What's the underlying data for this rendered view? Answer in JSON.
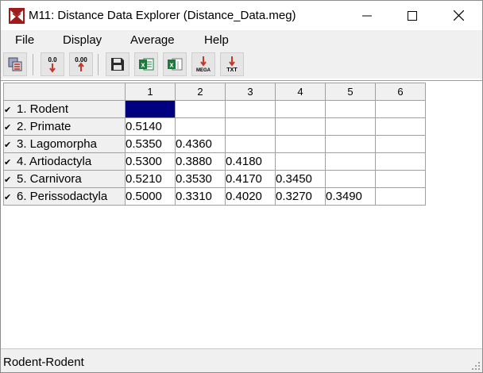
{
  "window": {
    "title": "M11: Distance Data Explorer (Distance_Data.meg)"
  },
  "menu": [
    "File",
    "Display",
    "Average",
    "Help"
  ],
  "toolbar": {
    "buttons": [
      {
        "name": "options-icon",
        "label": ""
      },
      {
        "name": "decrease-decimals-icon",
        "label": "0.0"
      },
      {
        "name": "increase-decimals-icon",
        "label": "0.00"
      },
      {
        "name": "save-icon",
        "label": ""
      },
      {
        "name": "export-excel-icon",
        "label": ""
      },
      {
        "name": "export-excel-alt-icon",
        "label": ""
      },
      {
        "name": "export-mega-icon",
        "label": "MEGA"
      },
      {
        "name": "export-txt-icon",
        "label": "TXT"
      }
    ]
  },
  "table": {
    "columns": [
      "1",
      "2",
      "3",
      "4",
      "5",
      "6"
    ],
    "rows": [
      {
        "label": "1. Rodent",
        "checked": true,
        "values": [
          "",
          "",
          "",
          "",
          "",
          ""
        ]
      },
      {
        "label": "2. Primate",
        "checked": true,
        "values": [
          "0.5140",
          "",
          "",
          "",
          "",
          ""
        ]
      },
      {
        "label": "3. Lagomorpha",
        "checked": true,
        "values": [
          "0.5350",
          "0.4360",
          "",
          "",
          "",
          ""
        ]
      },
      {
        "label": "4. Artiodactyla",
        "checked": true,
        "values": [
          "0.5300",
          "0.3880",
          "0.4180",
          "",
          "",
          ""
        ]
      },
      {
        "label": "5. Carnivora",
        "checked": true,
        "values": [
          "0.5210",
          "0.3530",
          "0.4170",
          "0.3450",
          "",
          ""
        ]
      },
      {
        "label": "6. Perissodactyla",
        "checked": true,
        "values": [
          "0.5000",
          "0.3310",
          "0.4020",
          "0.3270",
          "0.3490",
          ""
        ]
      }
    ]
  },
  "status": {
    "text": "Rodent-Rodent"
  },
  "colors": {
    "selection": "#000080",
    "header_bg": "#f0f0f0",
    "grid_line": "#a0a0a0",
    "excel_green": "#1d7a3c",
    "download_red": "#c0392b"
  }
}
